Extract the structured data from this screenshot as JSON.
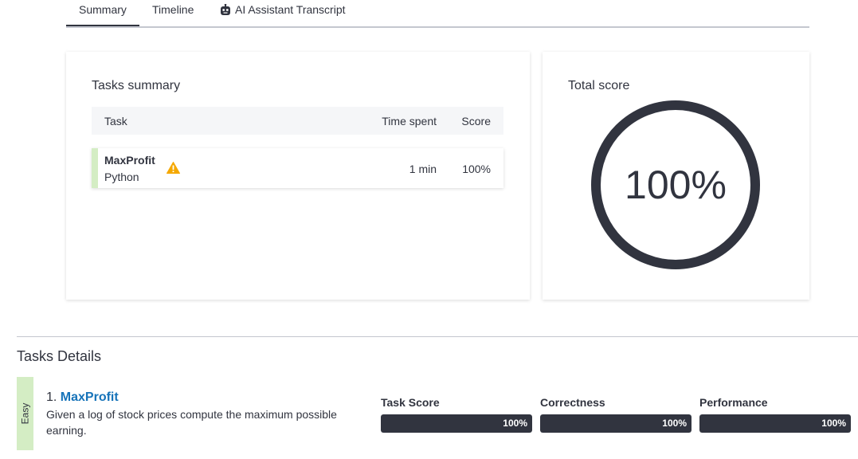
{
  "tabs": [
    {
      "label": "Summary",
      "active": true
    },
    {
      "label": "Timeline",
      "active": false
    },
    {
      "label": "AI Assistant Transcript",
      "active": false,
      "icon": "robot-icon"
    }
  ],
  "tasks_summary": {
    "title": "Tasks summary",
    "columns": {
      "task": "Task",
      "time": "Time spent",
      "score": "Score"
    },
    "rows": [
      {
        "name": "MaxProfit",
        "language": "Python",
        "warning_icon": "warning-icon",
        "time": "1 min",
        "score": "100%"
      }
    ]
  },
  "total_score": {
    "title": "Total score",
    "value": "100%",
    "fraction": 1.0
  },
  "tasks_details": {
    "title": "Tasks Details",
    "items": [
      {
        "number": "1.",
        "name": "MaxProfit",
        "difficulty": "Easy",
        "description": "Given a log of stock prices compute the maximum possible earning.",
        "metrics": [
          {
            "label": "Task Score",
            "value": "100%",
            "fraction": 1.0
          },
          {
            "label": "Correctness",
            "value": "100%",
            "fraction": 1.0
          },
          {
            "label": "Performance",
            "value": "100%",
            "fraction": 1.0
          }
        ]
      }
    ]
  },
  "colors": {
    "primary": "#31343f",
    "link": "#1673b9",
    "easy_accent": "#d4edc4",
    "warning": "#f5a800"
  }
}
